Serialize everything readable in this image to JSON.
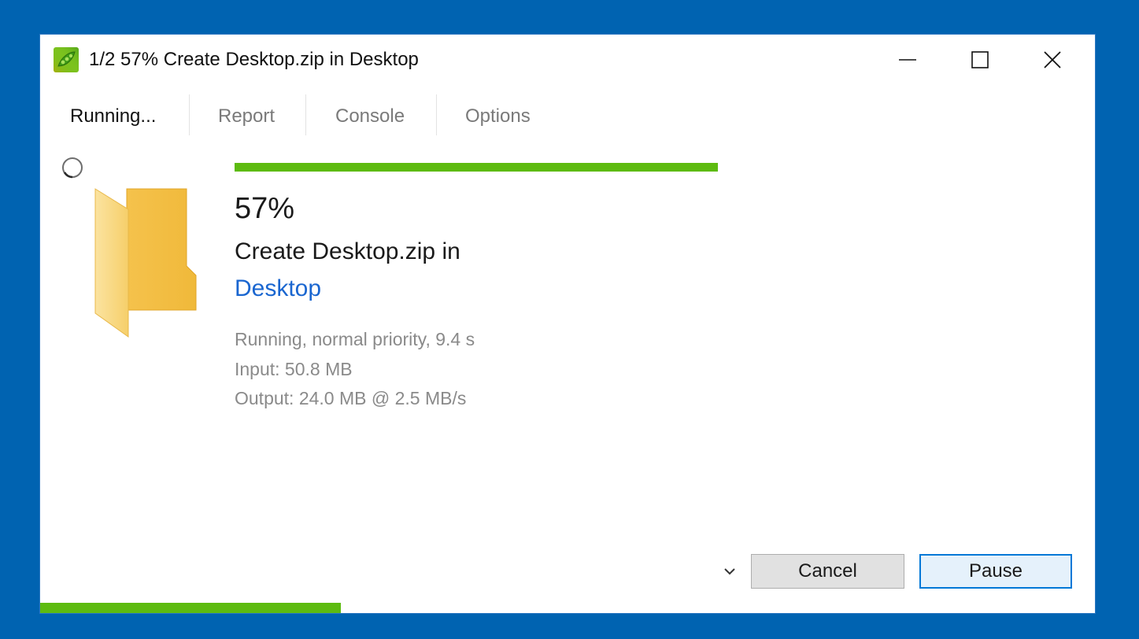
{
  "window": {
    "title": "1/2 57% Create Desktop.zip in Desktop",
    "icon": "peapod-app-icon"
  },
  "tabs": [
    {
      "label": "Running...",
      "active": true
    },
    {
      "label": "Report",
      "active": false
    },
    {
      "label": "Console",
      "active": false
    },
    {
      "label": "Options",
      "active": false
    }
  ],
  "job": {
    "progress_fraction": 0.57,
    "percent_text": "57%",
    "operation": "Create Desktop.zip in",
    "destination": "Desktop",
    "status": "Running, normal priority, 9.4 s",
    "input": "Input: 50.8 MB",
    "output": "Output: 24.0 MB @ 2.5 MB/s"
  },
  "overall": {
    "progress_fraction": 0.285
  },
  "buttons": {
    "cancel": "Cancel",
    "pause": "Pause"
  },
  "colors": {
    "desktop_bg": "#0063b1",
    "progress": "#5dbb10",
    "link": "#1a66d0",
    "accent": "#0078d7"
  }
}
